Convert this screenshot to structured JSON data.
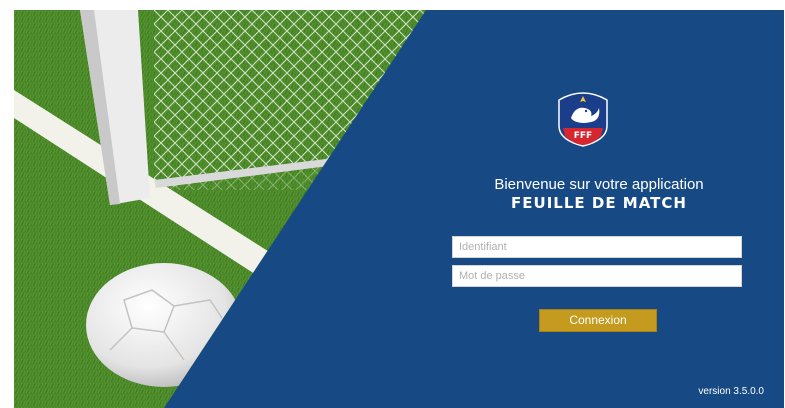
{
  "welcome": {
    "line1": "Bienvenue sur votre application",
    "app_name": "FEUILLE DE MATCH"
  },
  "form": {
    "username_placeholder": "Identifiant",
    "password_placeholder": "Mot de passe",
    "submit_label": "Connexion"
  },
  "footer": {
    "version": "version 3.5.0.0"
  },
  "logo": {
    "text": "FFF",
    "icon": "fff-rooster-crest-icon"
  },
  "colors": {
    "panel_blue": "#174a84",
    "button_gold": "#c49a1f",
    "grass_green": "#4f8a2a",
    "crest_red": "#d6262f"
  }
}
